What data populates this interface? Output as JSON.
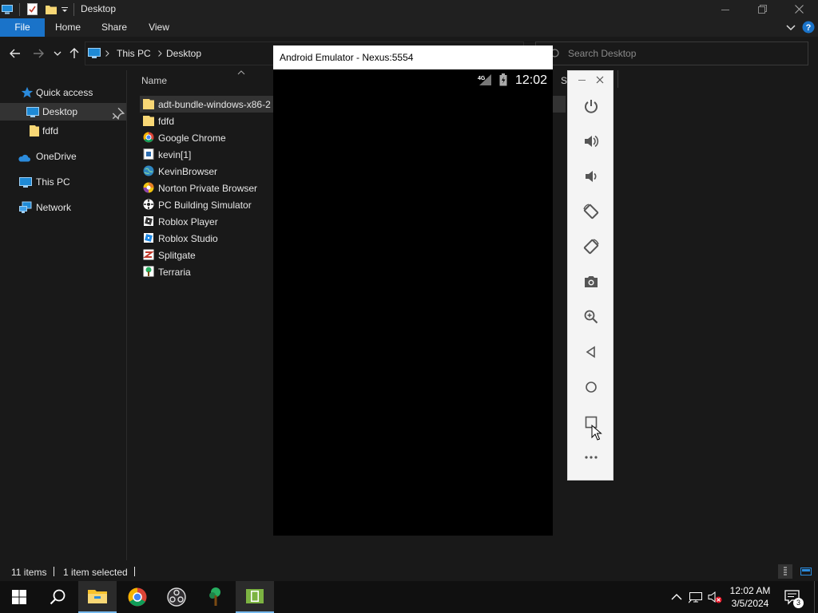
{
  "window": {
    "title": "Desktop",
    "quick_access_icons": [
      "pc-icon",
      "properties-icon",
      "new-folder-icon",
      "customize-arrow-icon"
    ]
  },
  "ribbon": {
    "tabs": [
      {
        "label": "File",
        "active": true
      },
      {
        "label": "Home"
      },
      {
        "label": "Share"
      },
      {
        "label": "View"
      }
    ]
  },
  "address": {
    "crumbs": [
      "This PC",
      "Desktop"
    ],
    "search_placeholder": "Search Desktop"
  },
  "nav_pane": {
    "items": [
      {
        "label": "Quick access",
        "icon": "star-icon"
      },
      {
        "label": "Desktop",
        "icon": "desktop-icon",
        "selected": true,
        "pinned": true
      },
      {
        "label": "fdfd",
        "icon": "folder-icon"
      },
      {
        "label": "OneDrive",
        "icon": "cloud-icon"
      },
      {
        "label": "This PC",
        "icon": "pc-icon"
      },
      {
        "label": "Network",
        "icon": "network-icon"
      }
    ]
  },
  "file_list": {
    "column_header": "Name",
    "items": [
      {
        "name": "adt-bundle-windows-x86-2",
        "icon": "folder-icon",
        "selected": true
      },
      {
        "name": "fdfd",
        "icon": "folder-icon"
      },
      {
        "name": "Google Chrome",
        "icon": "chrome-icon"
      },
      {
        "name": "kevin[1]",
        "icon": "document-icon"
      },
      {
        "name": "KevinBrowser",
        "icon": "globe-icon"
      },
      {
        "name": "Norton Private Browser",
        "icon": "norton-icon"
      },
      {
        "name": "PC Building Simulator",
        "icon": "game-icon"
      },
      {
        "name": "Roblox Player",
        "icon": "roblox-icon"
      },
      {
        "name": "Roblox Studio",
        "icon": "roblox-studio-icon"
      },
      {
        "name": "Splitgate",
        "icon": "splitgate-icon"
      },
      {
        "name": "Terraria",
        "icon": "terraria-icon"
      }
    ]
  },
  "status_bar": {
    "item_count": "11 items",
    "selection": "1 item selected"
  },
  "emulator": {
    "title": "Android Emulator - Nexus:5554",
    "status_time": "12:02",
    "network": "4G",
    "toolbar": [
      "power-icon",
      "volume-up-icon",
      "volume-down-icon",
      "rotate-left-icon",
      "rotate-right-icon",
      "camera-icon",
      "zoom-icon",
      "back-icon",
      "home-icon",
      "overview-icon",
      "more-icon"
    ]
  },
  "taskbar": {
    "apps": [
      "start-icon",
      "search-icon",
      "file-explorer-icon",
      "chrome-icon",
      "obs-icon",
      "terraria-icon",
      "emulator-icon"
    ],
    "clock_time": "12:02 AM",
    "clock_date": "3/5/2024",
    "notifications": "3",
    "colors": {
      "accent": "#1a73c9",
      "active_underline": "#76b9ed"
    }
  }
}
